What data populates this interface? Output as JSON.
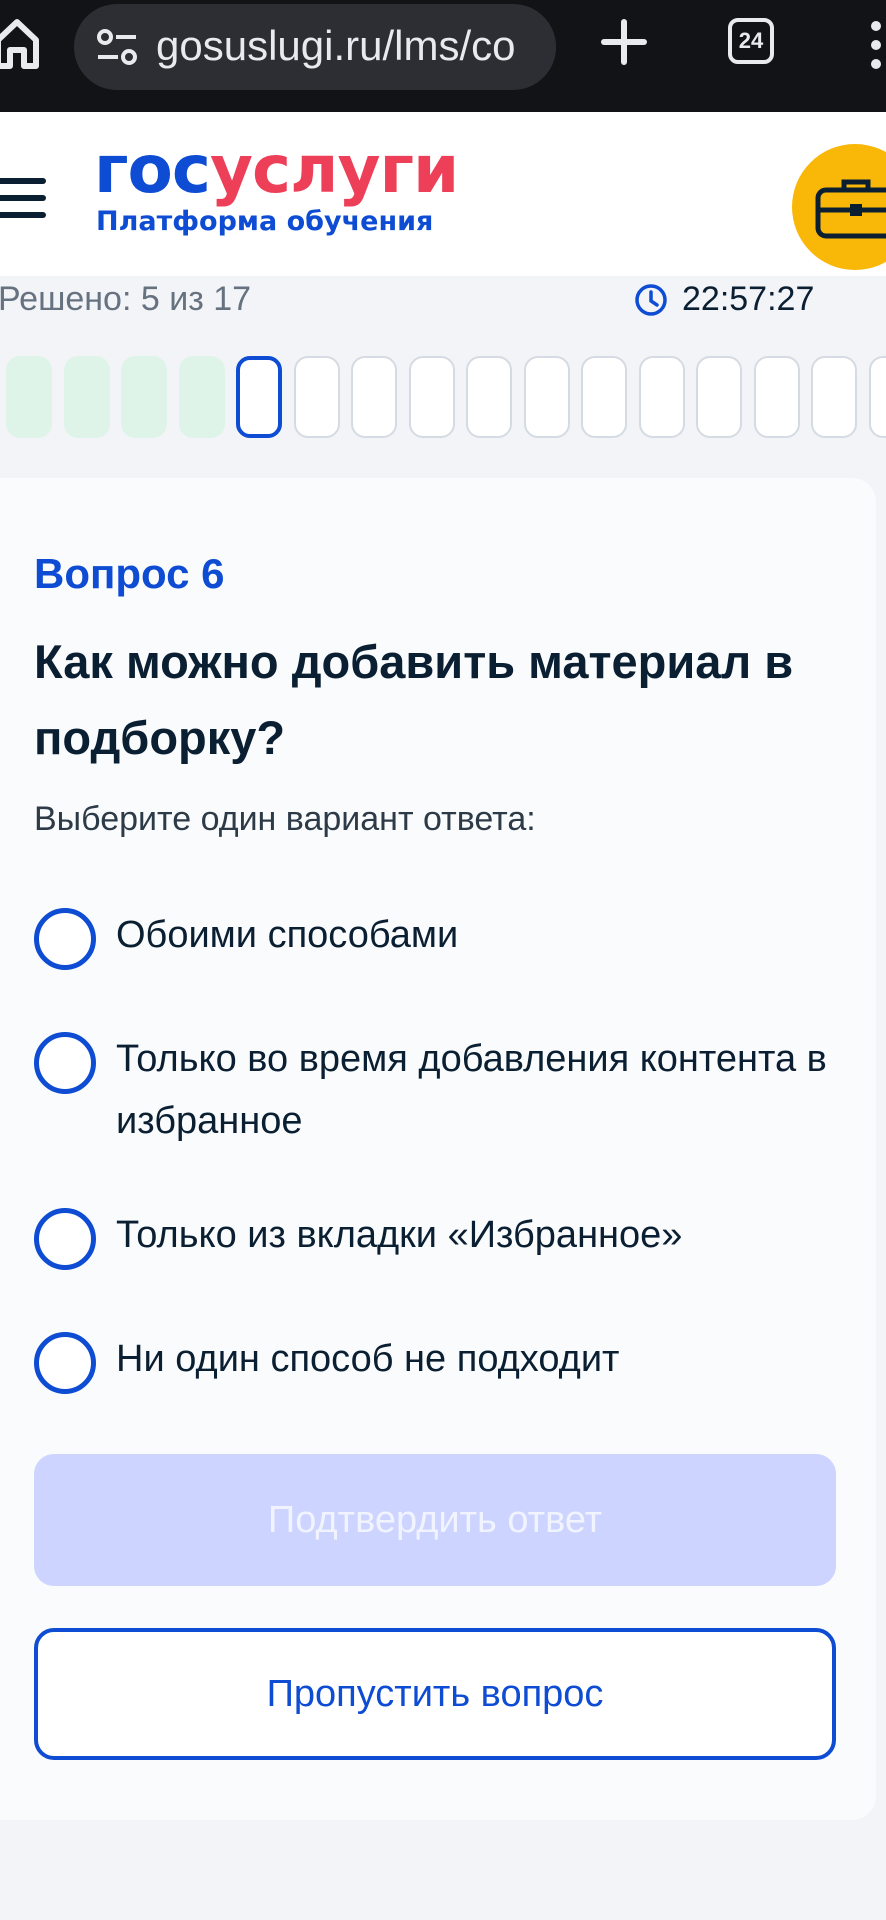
{
  "browser": {
    "url": "gosuslugi.ru/lms/co",
    "tab_count": "24"
  },
  "header": {
    "logo_part1": "гос",
    "logo_part2": "услуги",
    "logo_subtitle": "Платформа обучения"
  },
  "progress": {
    "solved_text": "Решено: 5 из 17",
    "timer": "22:57:27",
    "steps": [
      "done",
      "done",
      "done",
      "done",
      "current",
      "todo",
      "todo",
      "todo",
      "todo",
      "todo",
      "todo",
      "todo",
      "todo",
      "todo",
      "todo",
      "todo"
    ]
  },
  "question": {
    "number": "Вопрос 6",
    "title": "Как можно добавить материал в подборку?",
    "hint": "Выберите один вариант ответа:",
    "options": [
      "Обоими способами",
      "Только во время добавления контента в избранное",
      "Только из вкладки «Избранное»",
      "Ни один способ не подходит"
    ]
  },
  "actions": {
    "confirm_label": "Подтвердить ответ",
    "skip_label": "Пропустить вопрос"
  },
  "colors": {
    "primary": "#0d4cd3",
    "accent_red": "#ee3f58",
    "briefcase_yellow": "#f9b707",
    "step_done": "#dff4e8",
    "confirm_disabled": "#ccd4ff"
  }
}
